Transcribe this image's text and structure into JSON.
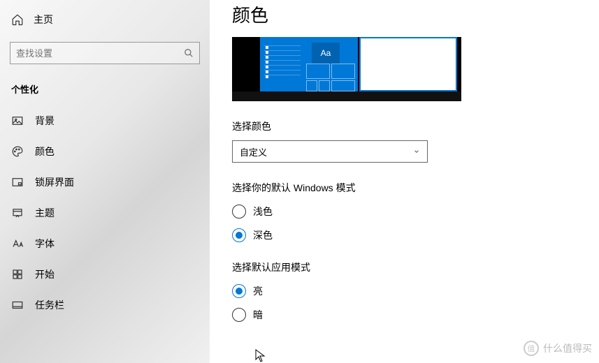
{
  "sidebar": {
    "home": "主页",
    "search_placeholder": "查找设置",
    "category": "个性化",
    "items": [
      {
        "label": "背景"
      },
      {
        "label": "颜色"
      },
      {
        "label": "锁屏界面"
      },
      {
        "label": "主题"
      },
      {
        "label": "字体"
      },
      {
        "label": "开始"
      },
      {
        "label": "任务栏"
      }
    ]
  },
  "main": {
    "title": "颜色",
    "preview_sample": "Aa",
    "color_section": "选择颜色",
    "color_value": "自定义",
    "windows_mode_section": "选择你的默认 Windows 模式",
    "windows_mode": {
      "light": "浅色",
      "dark": "深色"
    },
    "app_mode_section": "选择默认应用模式",
    "app_mode": {
      "light": "亮",
      "dark": "暗"
    }
  },
  "watermark": {
    "icon": "值",
    "text": "什么值得买"
  }
}
